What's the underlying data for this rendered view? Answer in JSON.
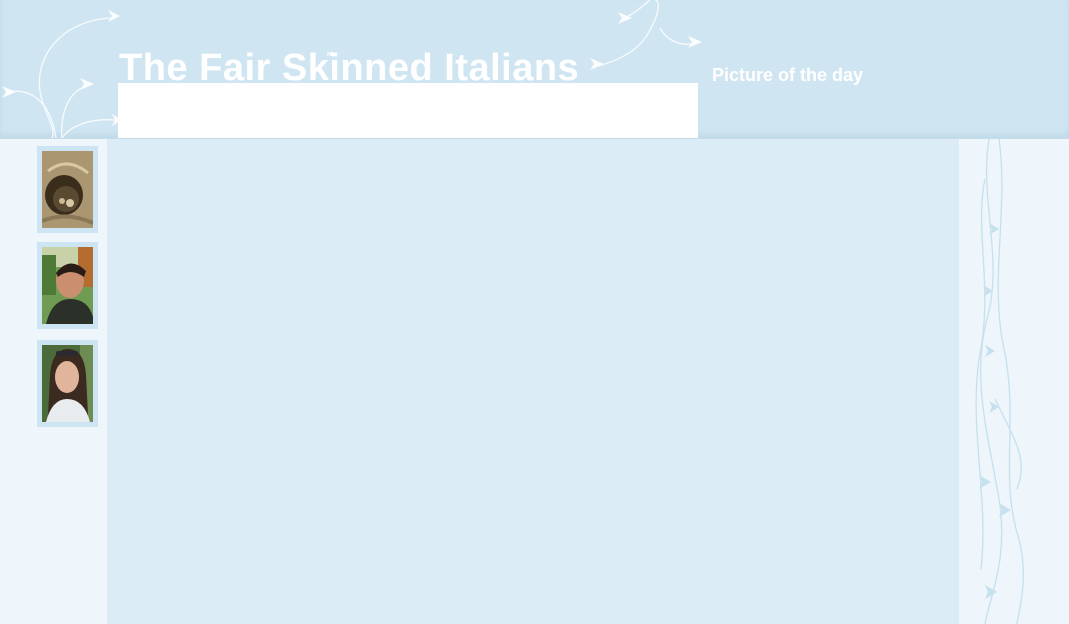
{
  "header": {
    "site_title": "The Fair Skinned Italians",
    "picture_of_the_day_label": "Picture of the day"
  },
  "sidebar": {
    "thumbnails": [
      {
        "subject": "ultrasound"
      },
      {
        "subject": "man-portrait"
      },
      {
        "subject": "woman-portrait"
      }
    ]
  },
  "colors": {
    "header_bg": "#cfe6f2",
    "main_bg": "#dbecf6",
    "side_bg": "#eef5fb",
    "thumb_frame": "#cde5f2"
  }
}
